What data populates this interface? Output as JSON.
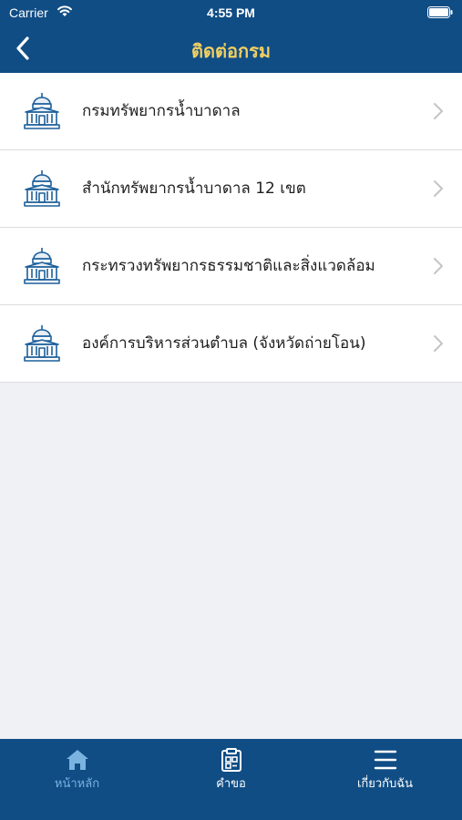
{
  "status_bar": {
    "carrier": "Carrier",
    "time": "4:55 PM"
  },
  "header": {
    "title": "ติดต่อกรม",
    "title_color": "#f1cf61",
    "background": "#104d85"
  },
  "list": {
    "items": [
      {
        "label": "กรมทรัพยากรน้ำบาดาล",
        "icon": "government-building-icon"
      },
      {
        "label": "สำนักทรัพยากรน้ำบาดาล 12 เขต",
        "icon": "government-building-icon"
      },
      {
        "label": "กระทรวงทรัพยากรธรรมชาติและสิ่งแวดล้อม",
        "icon": "government-building-icon"
      },
      {
        "label": "องค์การบริหารส่วนตำบล (จังหวัดถ่ายโอน)",
        "icon": "government-building-icon"
      }
    ]
  },
  "tabbar": {
    "tabs": [
      {
        "label": "หน้าหลัก",
        "icon": "home-icon",
        "active": true
      },
      {
        "label": "คำขอ",
        "icon": "clipboard-icon",
        "active": false
      },
      {
        "label": "เกี่ยวกับฉัน",
        "icon": "menu-icon",
        "active": false
      }
    ],
    "active_color": "#7ab2e0"
  }
}
